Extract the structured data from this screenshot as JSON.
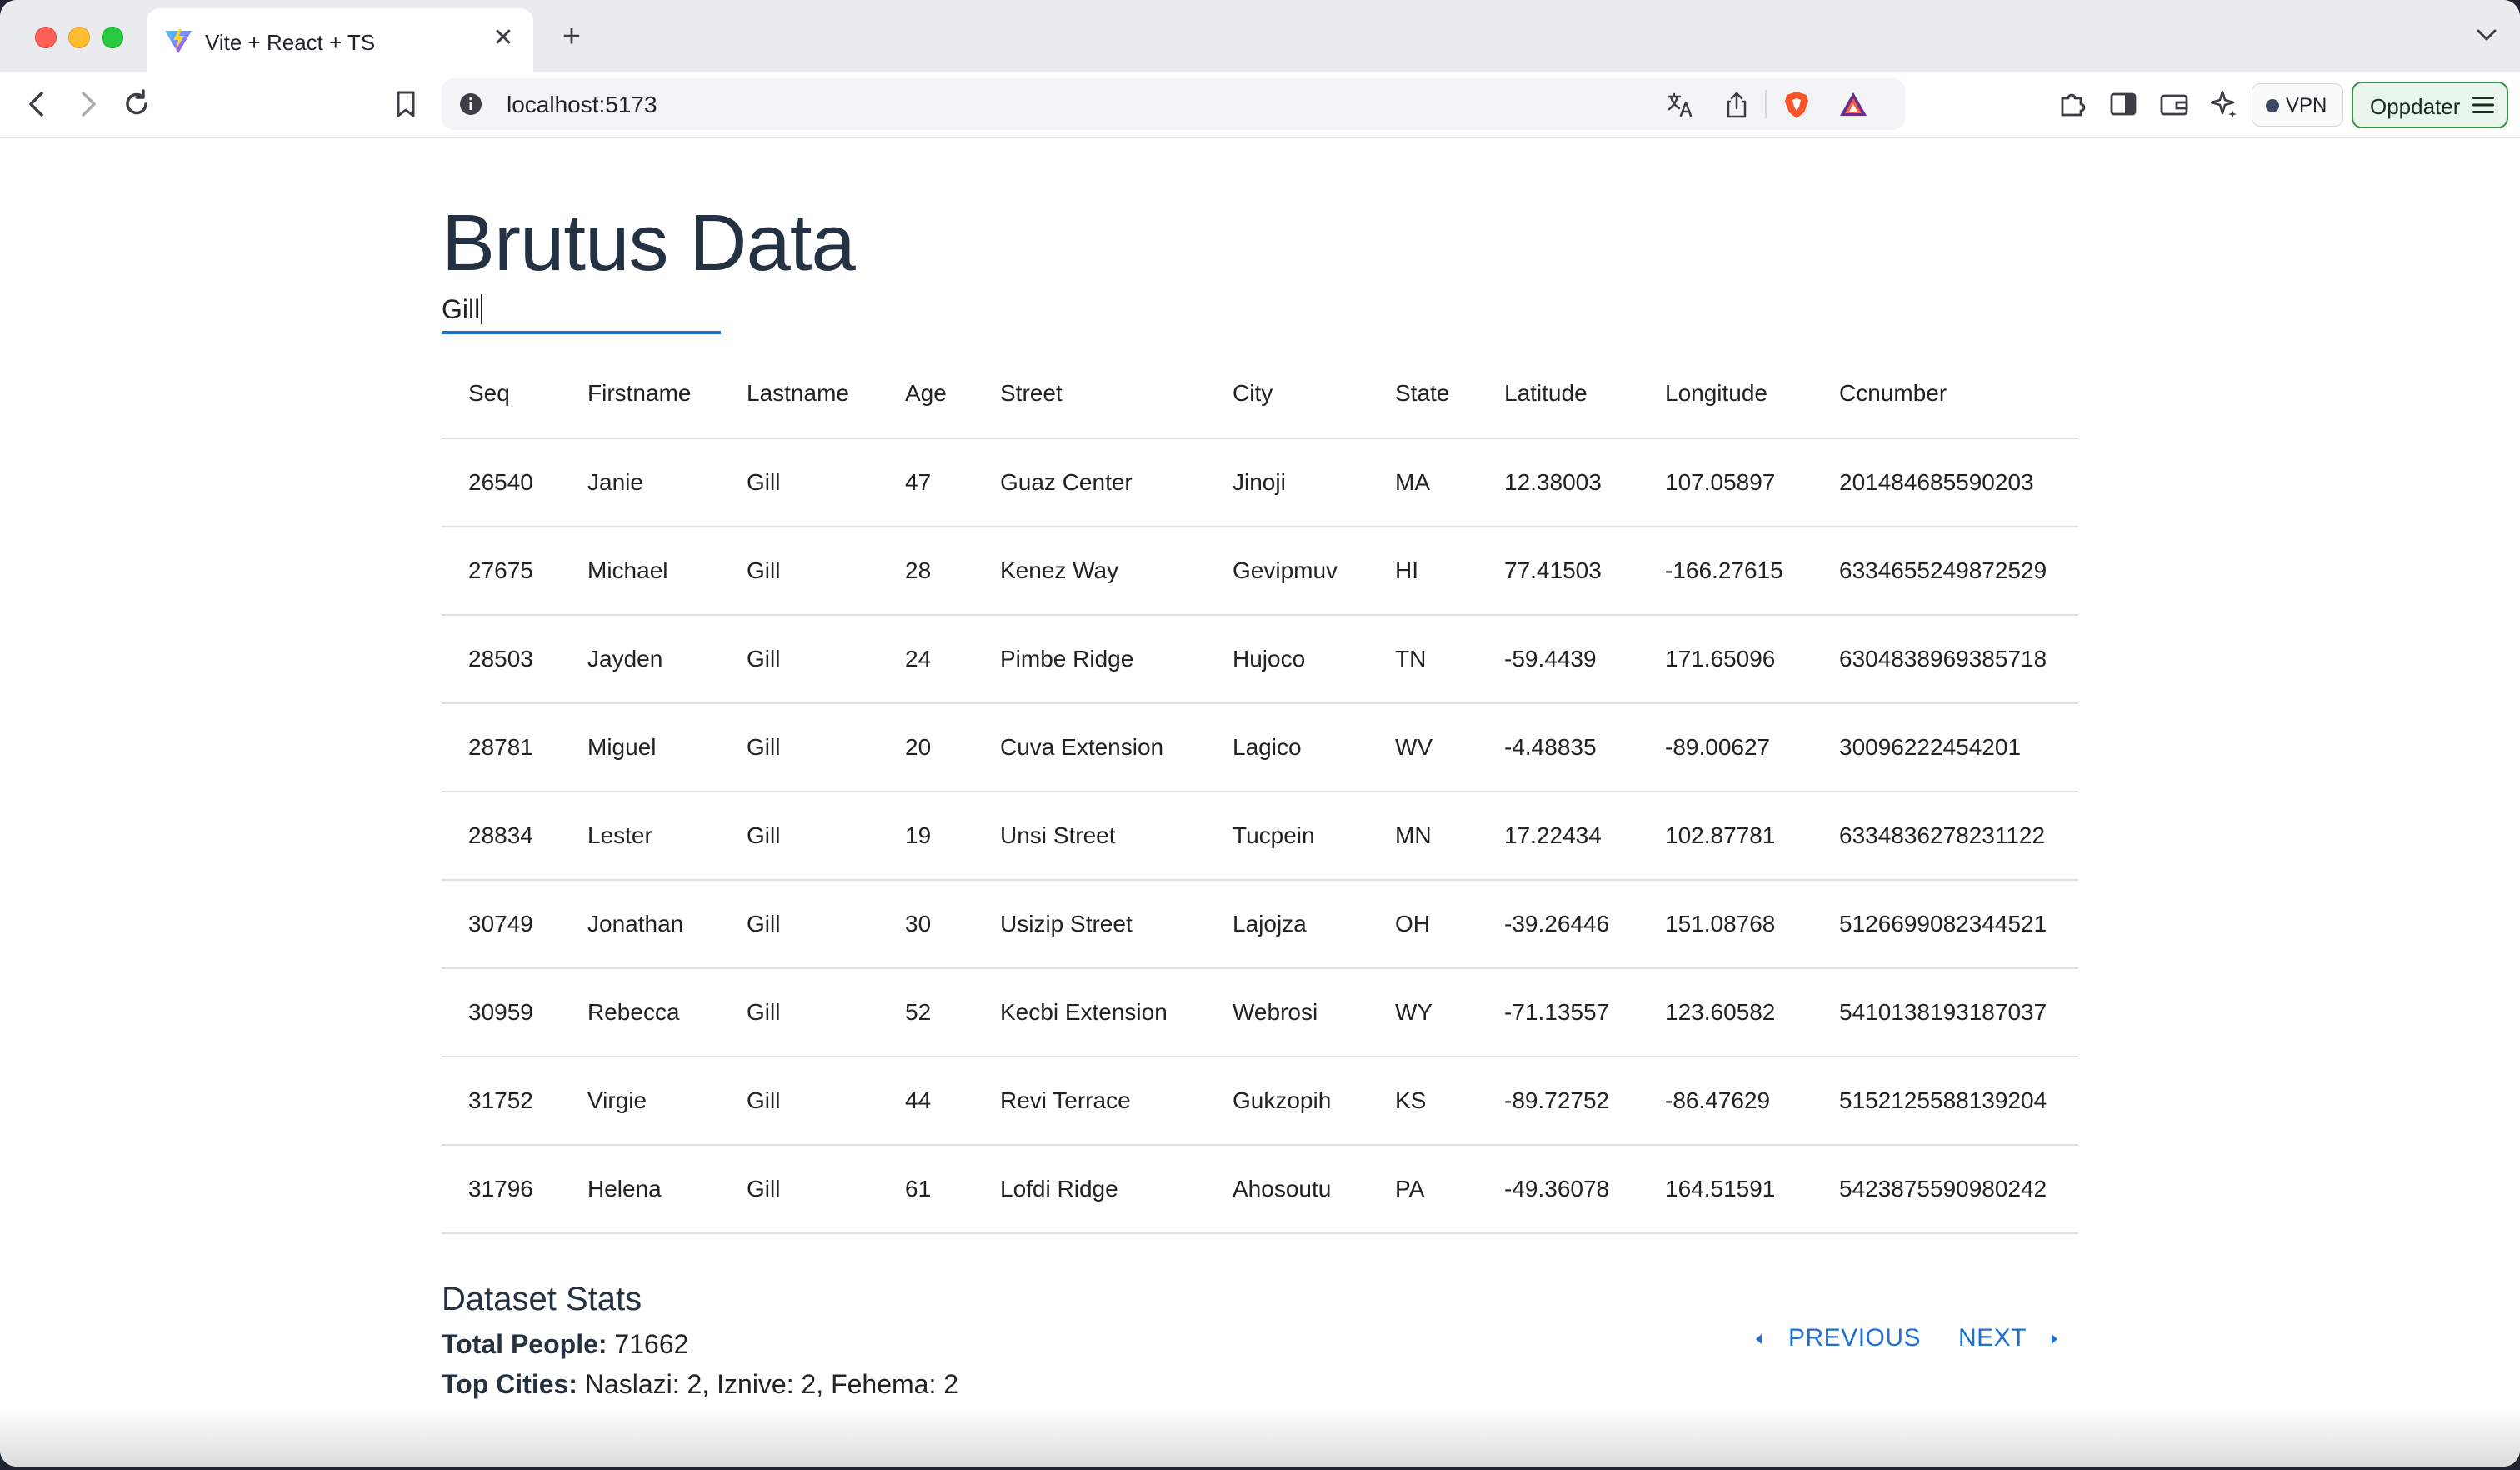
{
  "browser": {
    "tab_title": "Vite + React + TS",
    "tab_close": "✕",
    "new_tab": "+",
    "url": "localhost:5173",
    "vpn_label": "VPN",
    "update_label": "Oppdater"
  },
  "page": {
    "title": "Brutus Data",
    "search_value": "Gill"
  },
  "table": {
    "columns": [
      "Seq",
      "Firstname",
      "Lastname",
      "Age",
      "Street",
      "City",
      "State",
      "Latitude",
      "Longitude",
      "Ccnumber"
    ],
    "rows": [
      [
        "26540",
        "Janie",
        "Gill",
        "47",
        "Guaz Center",
        "Jinoji",
        "MA",
        "12.38003",
        "107.05897",
        "201484685590203"
      ],
      [
        "27675",
        "Michael",
        "Gill",
        "28",
        "Kenez Way",
        "Gevipmuv",
        "HI",
        "77.41503",
        "-166.27615",
        "6334655249872529"
      ],
      [
        "28503",
        "Jayden",
        "Gill",
        "24",
        "Pimbe Ridge",
        "Hujoco",
        "TN",
        "-59.4439",
        "171.65096",
        "6304838969385718"
      ],
      [
        "28781",
        "Miguel",
        "Gill",
        "20",
        "Cuva Extension",
        "Lagico",
        "WV",
        "-4.48835",
        "-89.00627",
        "30096222454201"
      ],
      [
        "28834",
        "Lester",
        "Gill",
        "19",
        "Unsi Street",
        "Tucpein",
        "MN",
        "17.22434",
        "102.87781",
        "6334836278231122"
      ],
      [
        "30749",
        "Jonathan",
        "Gill",
        "30",
        "Usizip Street",
        "Lajojza",
        "OH",
        "-39.26446",
        "151.08768",
        "5126699082344521"
      ],
      [
        "30959",
        "Rebecca",
        "Gill",
        "52",
        "Kecbi Extension",
        "Webrosi",
        "WY",
        "-71.13557",
        "123.60582",
        "5410138193187037"
      ],
      [
        "31752",
        "Virgie",
        "Gill",
        "44",
        "Revi Terrace",
        "Gukzopih",
        "KS",
        "-89.72752",
        "-86.47629",
        "5152125588139204"
      ],
      [
        "31796",
        "Helena",
        "Gill",
        "61",
        "Lofdi Ridge",
        "Ahosoutu",
        "PA",
        "-49.36078",
        "164.51591",
        "5423875590980242"
      ]
    ]
  },
  "stats": {
    "title": "Dataset Stats",
    "total_label": "Total People:",
    "total_value": "71662",
    "top_cities_label": "Top Cities:",
    "top_cities_value": "Naslazi: 2, Iznive: 2, Fehema: 2"
  },
  "pagination": {
    "previous": "PREVIOUS",
    "next": "NEXT"
  },
  "colors": {
    "accent": "#1d6fd6",
    "heading": "#243142",
    "update_border": "#3c8f47"
  },
  "icons": [
    "vite-logo-icon",
    "back-icon",
    "forward-icon",
    "reload-icon",
    "bookmark-icon",
    "info-icon",
    "translate-icon",
    "share-icon",
    "brave-shields-icon",
    "brave-rewards-icon",
    "extensions-icon",
    "sidebar-icon",
    "wallet-icon",
    "leo-ai-icon",
    "menu-icon",
    "caret-left-icon",
    "caret-right-icon"
  ]
}
